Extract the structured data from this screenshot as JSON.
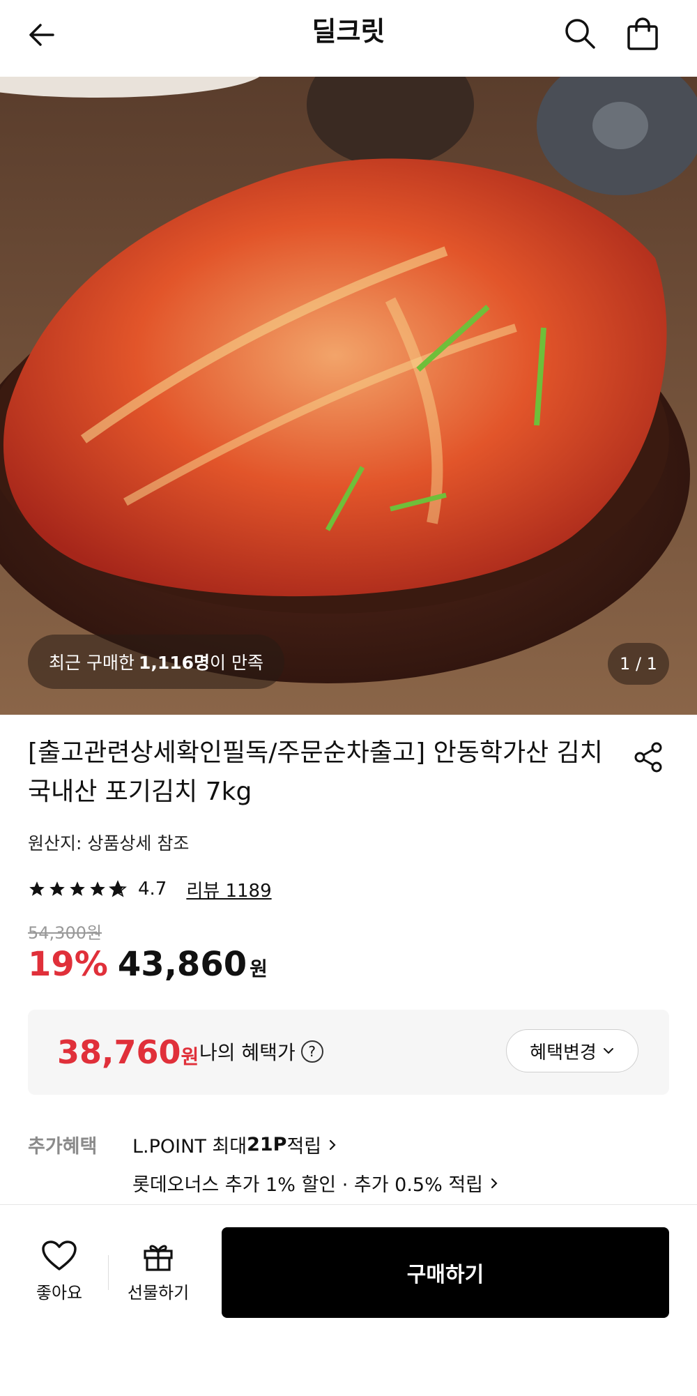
{
  "header": {
    "title": "딜크릿",
    "icons": [
      "back-arrow-icon",
      "search-icon",
      "shopping-bag-icon"
    ]
  },
  "hero": {
    "satisfied_prefix": "최근 구매한 ",
    "satisfied_count": "1,116명",
    "satisfied_suffix": "이 만족",
    "image_counter": "1 / 1"
  },
  "product": {
    "title": "[출고관련상세확인필독/주문순차출고] 안동학가산 김치 국내산 포기김치 7kg",
    "origin": "원산지: 상품상세 참조",
    "rating": "4.7",
    "rating_stars": 4.7,
    "review_link": "리뷰 1189",
    "original_price": "54,300원",
    "discount": "19%",
    "price": "43,860",
    "price_unit": "원"
  },
  "benefit": {
    "my_price": "38,760",
    "my_price_unit": "원",
    "my_price_label": "나의 혜택가",
    "help_symbol": "?",
    "change_button": "혜택변경"
  },
  "extra": {
    "label": "추가혜택",
    "line1_prefix": "L.POINT 최대 ",
    "line1_points": "21P",
    "line1_suffix": " 적립",
    "line2": "롯데오너스 추가 1% 할인 · 추가 0.5% 적립"
  },
  "bottom_bar": {
    "like_label": "좋아요",
    "gift_label": "선물하기",
    "buy_label": "구매하기"
  },
  "colors": {
    "accent_red": "#e0303a",
    "buy_button": "#000000"
  }
}
